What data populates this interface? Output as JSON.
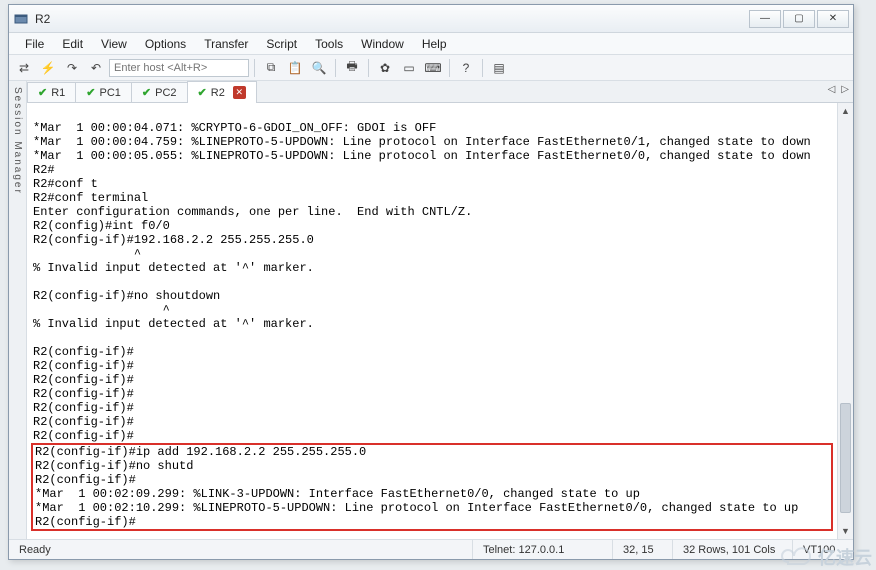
{
  "window": {
    "title": "R2"
  },
  "menu": {
    "items": [
      "File",
      "Edit",
      "View",
      "Options",
      "Transfer",
      "Script",
      "Tools",
      "Window",
      "Help"
    ]
  },
  "toolbar": {
    "host_placeholder": "Enter host <Alt+R>"
  },
  "side_panel": {
    "label": "Session Manager"
  },
  "tabs": {
    "items": [
      {
        "label": "R1",
        "active": false
      },
      {
        "label": "PC1",
        "active": false
      },
      {
        "label": "PC2",
        "active": false
      },
      {
        "label": "R2",
        "active": true
      }
    ]
  },
  "terminal": {
    "lines_top": [
      "*Mar  1 00:00:04.071: %CRYPTO-6-GDOI_ON_OFF: GDOI is OFF",
      "*Mar  1 00:00:04.759: %LINEPROTO-5-UPDOWN: Line protocol on Interface FastEthernet0/1, changed state to down",
      "*Mar  1 00:00:05.055: %LINEPROTO-5-UPDOWN: Line protocol on Interface FastEthernet0/0, changed state to down",
      "R2#",
      "R2#conf t",
      "R2#conf terminal",
      "Enter configuration commands, one per line.  End with CNTL/Z.",
      "R2(config)#int f0/0",
      "R2(config-if)#192.168.2.2 255.255.255.0",
      "              ^",
      "% Invalid input detected at '^' marker.",
      "",
      "R2(config-if)#no shoutdown",
      "                  ^",
      "% Invalid input detected at '^' marker.",
      "",
      "R2(config-if)#",
      "R2(config-if)#",
      "R2(config-if)#",
      "R2(config-if)#",
      "R2(config-if)#",
      "R2(config-if)#",
      "R2(config-if)#"
    ],
    "lines_box": [
      "R2(config-if)#ip add 192.168.2.2 255.255.255.0",
      "R2(config-if)#no shutd",
      "R2(config-if)#",
      "*Mar  1 00:02:09.299: %LINK-3-UPDOWN: Interface FastEthernet0/0, changed state to up",
      "*Mar  1 00:02:10.299: %LINEPROTO-5-UPDOWN: Line protocol on Interface FastEthernet0/0, changed state to up",
      "R2(config-if)#"
    ]
  },
  "status": {
    "ready": "Ready",
    "connection": "Telnet: 127.0.0.1",
    "cursor": "32, 15",
    "size": "32 Rows, 101 Cols",
    "emulation": "VT100"
  },
  "watermark": "亿速云"
}
